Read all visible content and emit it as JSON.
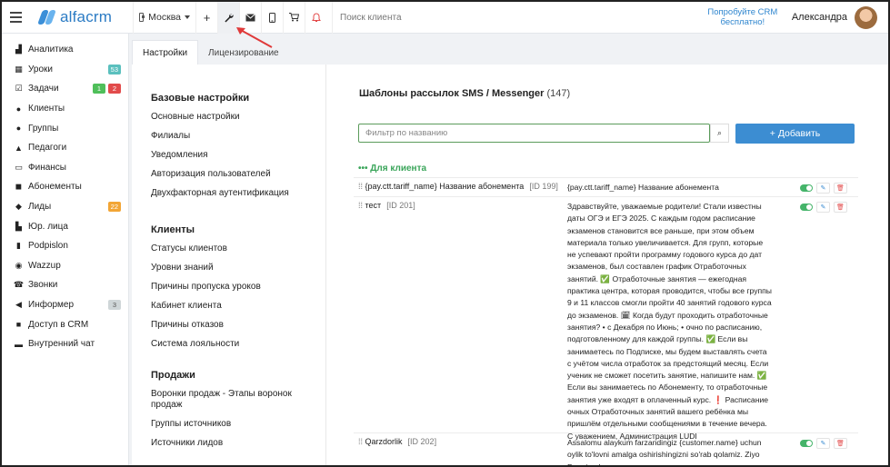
{
  "topbar": {
    "logo_text": "alfacrm",
    "branch": "Москва",
    "add_glyph": "+",
    "search_placeholder": "Поиск клиента",
    "promo": "Попробуйте CRM бесплатно!",
    "user_name": "Александра",
    "icons": [
      "plus-icon",
      "wrench-icon",
      "mail-icon",
      "phone-icon",
      "cart-icon",
      "bell-icon"
    ]
  },
  "sidebar": {
    "items": [
      {
        "label": "Аналитика",
        "icon": "chart-icon"
      },
      {
        "label": "Уроки",
        "icon": "calendar-icon",
        "badges": [
          {
            "text": "53",
            "color": "#5bc0be"
          }
        ]
      },
      {
        "label": "Задачи",
        "icon": "tasks-icon",
        "badges": [
          {
            "text": "1",
            "color": "#4fbf5a"
          },
          {
            "text": "2",
            "color": "#e24b4b"
          }
        ]
      },
      {
        "label": "Клиенты",
        "icon": "user-icon"
      },
      {
        "label": "Группы",
        "icon": "users-icon"
      },
      {
        "label": "Педагоги",
        "icon": "graduation-icon"
      },
      {
        "label": "Финансы",
        "icon": "money-icon"
      },
      {
        "label": "Абонементы",
        "icon": "ticket-icon"
      },
      {
        "label": "Лиды",
        "icon": "lead-icon",
        "badges": [
          {
            "text": "22",
            "color": "#f2a535"
          }
        ]
      },
      {
        "label": "Юр. лица",
        "icon": "building-icon"
      },
      {
        "label": "Podpislon",
        "icon": "document-icon"
      },
      {
        "label": "Wazzup",
        "icon": "whatsapp-icon"
      },
      {
        "label": "Звонки",
        "icon": "phone-icon"
      },
      {
        "label": "Информер",
        "icon": "bullhorn-icon",
        "badges": [
          {
            "text": "3",
            "color": "#cfd6d8"
          }
        ]
      },
      {
        "label": "Доступ в CRM",
        "icon": "lock-icon"
      },
      {
        "label": "Внутренний чат",
        "icon": "chat-icon"
      }
    ]
  },
  "tabs": [
    {
      "label": "Настройки"
    },
    {
      "label": "Лицензирование"
    }
  ],
  "settings": {
    "sections": [
      {
        "title": "Базовые настройки",
        "links": [
          "Основные настройки",
          "Филиалы",
          "Уведомления",
          "Авторизация пользователей",
          "Двухфакторная аутентификация"
        ]
      },
      {
        "title": "Клиенты",
        "links": [
          "Статусы клиентов",
          "Уровни знаний",
          "Причины пропуска уроков",
          "Кабинет клиента",
          "Причины отказов",
          "Система лояльности"
        ]
      },
      {
        "title": "Продажи",
        "links": [
          "Воронки продаж - Этапы воронок продаж",
          "Группы источников",
          "Источники лидов"
        ]
      }
    ]
  },
  "main": {
    "title": "Шаблоны рассылок SMS / Messenger",
    "count": "(147)",
    "filter_placeholder": "Фильтр по названию",
    "search_glyph": "⌕",
    "add_button": "+ Добавить",
    "group_title": "••• Для клиента",
    "row_glyph": "⁞⁞",
    "toggle_color": "#45b46a",
    "edit_glyph": "✎",
    "delete_glyph": "🗑",
    "templates": [
      {
        "name": "{pay.ctt.tariff_name} Название абонемента",
        "id": "[ID 199]",
        "text": "{pay.ctt.tariff_name} Название абонемента"
      },
      {
        "name": "тест",
        "id": "[ID 201]",
        "text": "Здравствуйте, уважаемые родители! Стали известны даты ОГЭ и ЕГЭ 2025. С каждым годом расписание экзаменов становится все раньше, при этом объем материала только увеличивается. Для групп, которые не успевают пройти программу годового курса до дат экзаменов, был составлен график Отработочных занятий. ✅ Отработочные занятия — ежегодная практика центра, которая проводится, чтобы все группы 9 и 11 классов смогли пройти 40 занятий годового курса до экзаменов. 🗓 Когда будут проходить отработочные занятия? • с Декабря по Июнь; • очно по расписанию, подготовленному для каждой группы. ✅ Если вы занимаетесь по Подписке, мы будем выставлять счета с учётом числа отработок за предстоящий месяц. Если ученик не сможет посетить занятие, напишите нам. ✅ Если вы занимаетесь по Абонементу, то отработочные занятия уже входят в оплаченный курс. ❗ Расписание очных Отработочных занятий вашего ребёнка мы пришлём отдельными сообщениями в течение вечера. С уважением, Администрация LUDI"
      },
      {
        "name": "Qarzdorlik",
        "id": "[ID 202]",
        "text": "Assalomu alaykum farzandingiz {customer.name} uchun oylik to'lovni amalga oshirishingizni so'rab qolamiz. Ziyo Premium!"
      }
    ]
  }
}
